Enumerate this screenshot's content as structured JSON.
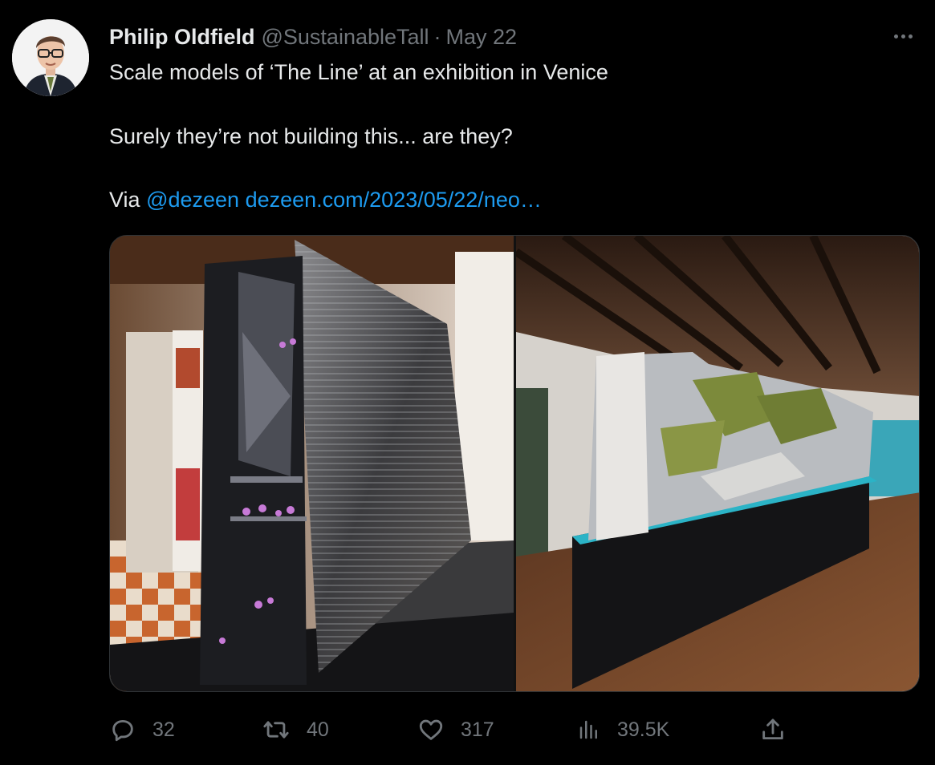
{
  "tweet": {
    "author": {
      "display_name": "Philip Oldfield",
      "handle": "@SustainableTall",
      "separator": "·",
      "date": "May 22"
    },
    "text": {
      "line1": "Scale models of ‘The Line’ at an exhibition in Venice",
      "line2": "Surely they’re not building this... are they?",
      "via_label": "Via",
      "mention": "@dezeen",
      "url": "dezeen.com/2023/05/22/neo…"
    },
    "media": {
      "left_image": "scale-model-tower-photo",
      "right_image": "exhibition-hall-model-photo"
    },
    "actions": {
      "replies": "32",
      "retweets": "40",
      "likes": "317",
      "views": "39.5K"
    },
    "icons": {
      "reply": "reply-icon",
      "retweet": "retweet-icon",
      "like": "heart-icon",
      "views": "views-icon",
      "share": "share-icon",
      "more": "more-icon"
    },
    "colors": {
      "background": "#000000",
      "text": "#e7e9ea",
      "muted": "#71767b",
      "link": "#1d9bf0"
    }
  }
}
